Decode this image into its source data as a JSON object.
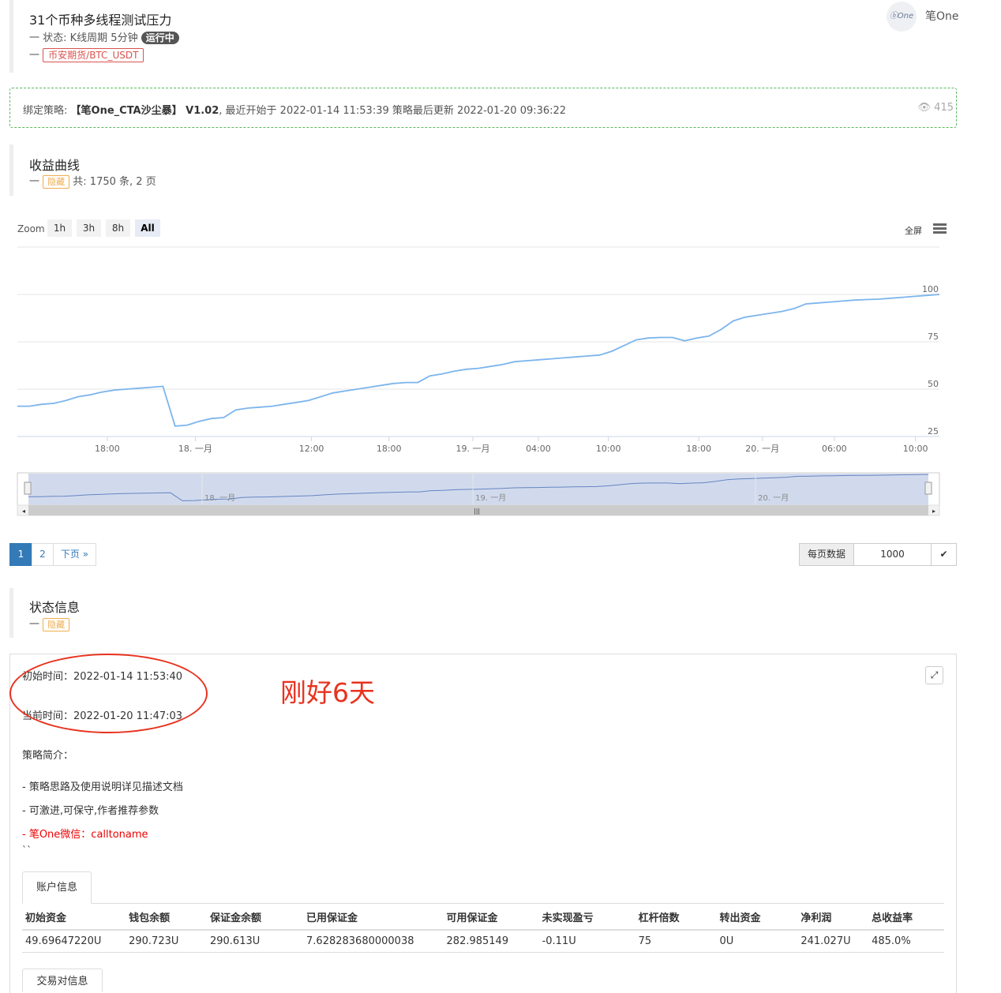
{
  "header": {
    "title": "31个币种多线程测试压力",
    "status_prefix": "一 状态: K线周期 5分钟",
    "status_badge": "运行中",
    "dash": "一",
    "exchange_badge": "币安期货/BTC_USDT",
    "user_name": "笔One",
    "avatar_text": "ⓑOne"
  },
  "strategy_bar": {
    "label": "绑定策略:",
    "strategy_name": "【笔One_CTA沙尘暴】 V1.02",
    "started_text": ", 最近开始于 2022-01-14 11:53:39 策略最后更新 2022-01-20 09:36:22",
    "views": "415"
  },
  "profit_section": {
    "title": "收益曲线",
    "dash": "一",
    "hide_label": "隐藏",
    "count_text": "共: 1750 条, 2 页"
  },
  "chart_toolbar": {
    "zoom_label": "Zoom",
    "zoom_buttons": [
      "1h",
      "3h",
      "8h",
      "All"
    ],
    "fullscreen_label": "全屏"
  },
  "chart_data": {
    "type": "line",
    "title": "",
    "xlabel": "",
    "ylabel": "",
    "ylim": [
      25,
      100
    ],
    "y_ticks": [
      "100",
      "75",
      "50",
      "25"
    ],
    "x_ticks": [
      "18:00",
      "18. 一月",
      "12:00",
      "18:00",
      "19. 一月",
      "04:00",
      "10:00",
      "18:00",
      "20. 一月",
      "06:00",
      "10:00"
    ],
    "navigator_ticks": [
      "18. 一月",
      "19. 一月",
      "20. 一月"
    ],
    "grid": true,
    "series": [
      {
        "values": [
          41,
          41,
          42,
          42.5,
          44,
          46,
          47,
          48.5,
          49.5,
          50,
          50.5,
          51,
          51.5,
          30.5,
          31,
          33,
          34.5,
          35,
          39,
          40,
          40.5,
          41,
          42,
          43,
          44,
          46,
          48,
          49,
          50,
          51,
          52,
          53,
          53.5,
          53.5,
          57,
          58,
          59.5,
          60.5,
          61,
          62,
          63,
          64.5,
          65,
          65.5,
          66,
          66.5,
          67,
          67.5,
          68,
          70,
          73,
          76,
          77,
          77.3,
          77.3,
          75.5,
          77,
          78,
          81.5,
          86,
          88,
          89,
          90,
          91,
          92.5,
          95,
          95.5,
          96,
          96.5,
          97,
          97.3,
          97.5,
          98,
          98.5,
          99,
          99.5,
          100
        ]
      }
    ]
  },
  "pagination": {
    "pages": [
      "1",
      "2"
    ],
    "next_label": "下页 »",
    "per_page_label": "每页数据",
    "per_page_value": "1000",
    "confirm_icon": "check-icon"
  },
  "status_section": {
    "title": "状态信息",
    "dash": "一",
    "hide_label": "隐藏"
  },
  "status_content": {
    "start_time": "初始时间：2022-01-14 11:53:40",
    "current_time": "当前时间：2022-01-20 11:47:03",
    "annotation": "刚好6天",
    "intro_label": "策略简介：",
    "intro_lines": [
      "- 策略思路及使用说明详见描述文档",
      "- 可激进,可保守,作者推荐参数"
    ],
    "contact_line": "- 笔One微信：calltoname",
    "backtick": "``"
  },
  "account_tab": {
    "tab_label": "账户信息",
    "columns": [
      "初始资金",
      "钱包余额",
      "保证金余额",
      "已用保证金",
      "可用保证金",
      "未实现盈亏",
      "杠杆倍数",
      "转出资金",
      "净利润",
      "总收益率"
    ],
    "row": [
      "49.69647220U",
      "290.723U",
      "290.613U",
      "7.628283680000038",
      "282.985149",
      "-0.11U",
      "75",
      "0U",
      "241.027U",
      "485.0%"
    ],
    "next_tab_label": "交易对信息"
  },
  "colors": {
    "line": "#7cb5ec",
    "annotation_red": "#e8321e",
    "link_blue": "#337ab7"
  }
}
